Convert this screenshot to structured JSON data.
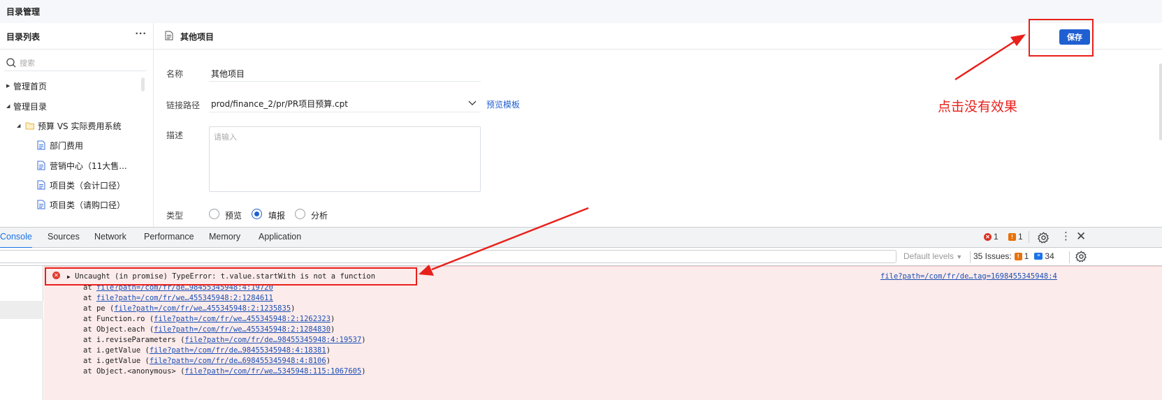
{
  "app": {
    "title": "目录管理"
  },
  "sidebar": {
    "title": "目录列表",
    "more_label": "···",
    "search_placeholder": "搜索",
    "items": [
      {
        "label": "管理首页",
        "expanded": false
      },
      {
        "label": "管理目录",
        "expanded": true
      },
      {
        "label": "预算 VS 实际费用系统",
        "expanded": true,
        "icon": "folder-icon"
      },
      {
        "label": "部门费用",
        "icon": "file-icon"
      },
      {
        "label": "营销中心（11大售...",
        "icon": "file-icon"
      },
      {
        "label": "项目类（会计口径）",
        "icon": "file-icon"
      },
      {
        "label": "项目类（请购口径）",
        "icon": "file-icon"
      }
    ]
  },
  "main": {
    "header_title": "其他项目",
    "save_label": "保存",
    "form": {
      "name_label": "名称",
      "name_value": "其他项目",
      "path_label": "链接路径",
      "path_value": "prod/finance_2/pr/PR项目预算.cpt",
      "preview_link": "预览模板",
      "desc_label": "描述",
      "desc_placeholder": "请输入",
      "type_label": "类型",
      "type_options": [
        "预览",
        "填报",
        "分析"
      ],
      "type_selected": "填报"
    }
  },
  "devtools": {
    "tabs": [
      "Console",
      "Sources",
      "Network",
      "Performance",
      "Memory",
      "Application"
    ],
    "active_tab": "Console",
    "error_count": "1",
    "warning_count": "1",
    "default_levels": "Default levels",
    "issues_label": "35 Issues:",
    "issues_warn": "1",
    "issues_info": "34",
    "error_message": "Uncaught (in promise) TypeError: t.value.startWith is not a function",
    "error_source": "file?path=/com/fr/de…tag=1698455345948:4",
    "stack": [
      {
        "prefix": "at ",
        "fn": "",
        "link": "file?path=/com/fr/de…98455345948:4:19720",
        "paren": false
      },
      {
        "prefix": "at ",
        "fn": "",
        "link": "file?path=/com/fr/we…455345948:2:1284611",
        "paren": false
      },
      {
        "prefix": "at ",
        "fn": "pe",
        "link": "file?path=/com/fr/we…455345948:2:1235835",
        "paren": true
      },
      {
        "prefix": "at ",
        "fn": "Function.ro",
        "link": "file?path=/com/fr/we…455345948:2:1262323",
        "paren": true
      },
      {
        "prefix": "at ",
        "fn": "Object.each",
        "link": "file?path=/com/fr/we…455345948:2:1284830",
        "paren": true
      },
      {
        "prefix": "at ",
        "fn": "i.reviseParameters",
        "link": "file?path=/com/fr/de…98455345948:4:19537",
        "paren": true
      },
      {
        "prefix": "at ",
        "fn": "i.getValue",
        "link": "file?path=/com/fr/de…98455345948:4:18381",
        "paren": true
      },
      {
        "prefix": "at ",
        "fn": "i.getValue",
        "link": "file?path=/com/fr/de…698455345948:4:8106",
        "paren": true
      },
      {
        "prefix": "at ",
        "fn": "Object.<anonymous>",
        "link": "file?path=/com/fr/we…5345948:115:1067605",
        "paren": true
      }
    ]
  },
  "annotation": {
    "text": "点击没有效果",
    "color": "#e8201b"
  }
}
